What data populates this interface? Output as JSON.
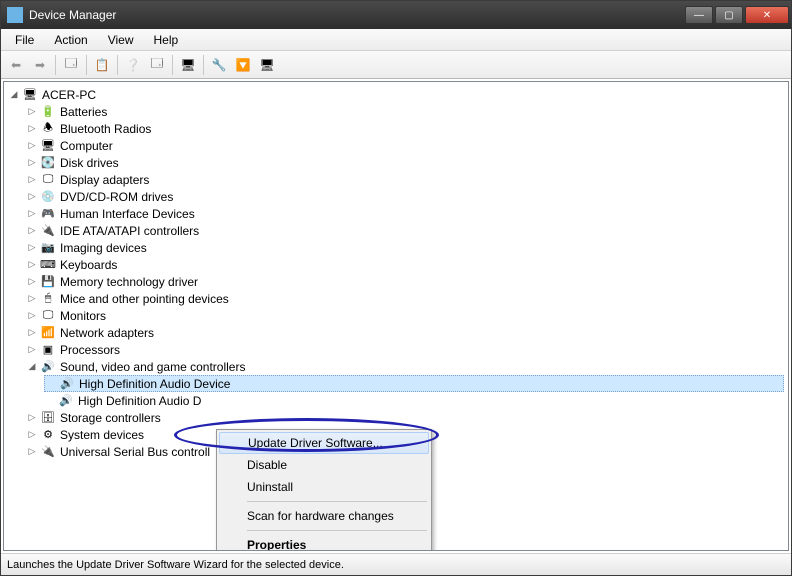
{
  "window": {
    "title": "Device Manager"
  },
  "menu": {
    "file": "File",
    "action": "Action",
    "view": "View",
    "help": "Help"
  },
  "tree": {
    "root": "ACER-PC",
    "items": [
      "Batteries",
      "Bluetooth Radios",
      "Computer",
      "Disk drives",
      "Display adapters",
      "DVD/CD-ROM drives",
      "Human Interface Devices",
      "IDE ATA/ATAPI controllers",
      "Imaging devices",
      "Keyboards",
      "Memory technology driver",
      "Mice and other pointing devices",
      "Monitors",
      "Network adapters",
      "Processors"
    ],
    "sound_label": "Sound, video and game controllers",
    "sound_children": [
      "High Definition Audio Device",
      "High Definition Audio D"
    ],
    "after": [
      "Storage controllers",
      "System devices",
      "Universal Serial Bus controll"
    ]
  },
  "context": {
    "update": "Update Driver Software...",
    "disable": "Disable",
    "uninstall": "Uninstall",
    "scan": "Scan for hardware changes",
    "properties": "Properties"
  },
  "status": "Launches the Update Driver Software Wizard for the selected device."
}
